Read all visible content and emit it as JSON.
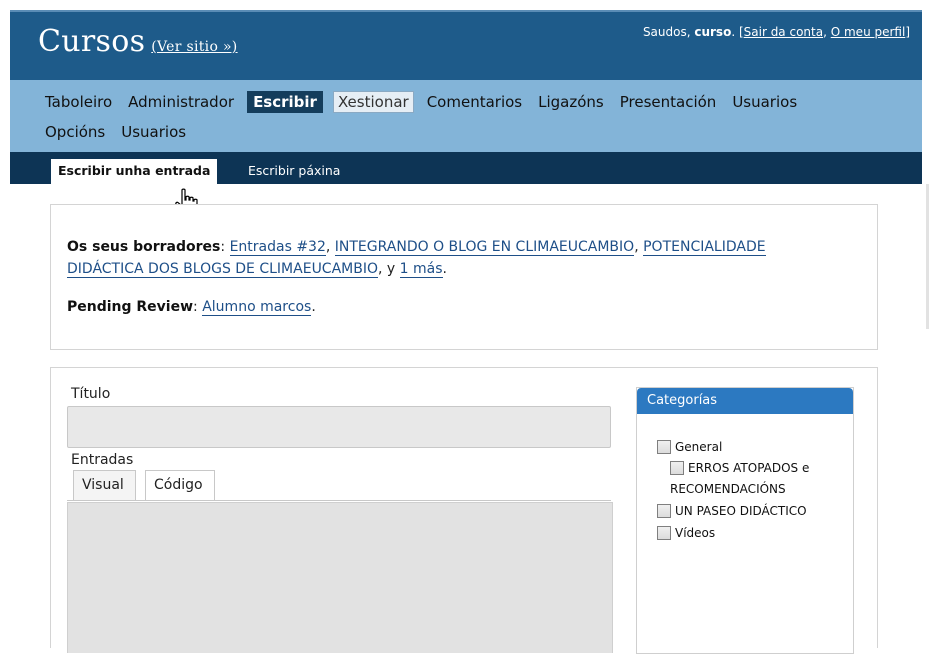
{
  "header": {
    "site_title": "Cursos",
    "visit_site": "(Ver sitio »)",
    "greeting": "Saudos, ",
    "username": "curso",
    "sep1": ". [",
    "logout": "Sair da conta",
    "sep2": ", ",
    "profile": "O meu perfil",
    "sep3": "]"
  },
  "nav": {
    "row1": [
      "Taboleiro",
      "Administrador",
      "Escribir",
      "Xestionar",
      "Comentarios",
      "Ligazóns",
      "Presentación",
      "Usuarios"
    ],
    "row2": [
      "Opcións",
      "Usuarios"
    ],
    "active": "Escribir"
  },
  "subnav": [
    "Escribir unha entrada",
    "Escribir páxina"
  ],
  "drafts": {
    "label": "Os seus borradores",
    "colon": ": ",
    "links": [
      "Entradas #32",
      "INTEGRANDO O BLOG EN CLIMAEUCAMBIO",
      "POTENCIALIDADE",
      "DIDÁCTICA DOS BLOGS DE CLIMAEUCAMBIO"
    ],
    "and": ", y ",
    "more": "1 más",
    "end": ".",
    "pending_label": "Pending Review",
    "pending_colon": ": ",
    "pending_link": "Alumno marcos",
    "pending_end": "."
  },
  "post": {
    "title_label": "Título",
    "title_value": "",
    "content_label": "Entradas",
    "tab_visual": "Visual",
    "tab_code": "Código"
  },
  "categories": {
    "title": "Categorías",
    "items": [
      "General",
      "ERROS ATOPADOS e",
      "RECOMENDACIÓNS",
      "UN PASEO DIDÁCTICO",
      "Vídeos"
    ]
  },
  "colors": {
    "header": "#1e5b8a",
    "nav": "#83b4d8",
    "subnav": "#0d3455",
    "cat_header": "#2c79c1",
    "link": "#1e4f88"
  }
}
